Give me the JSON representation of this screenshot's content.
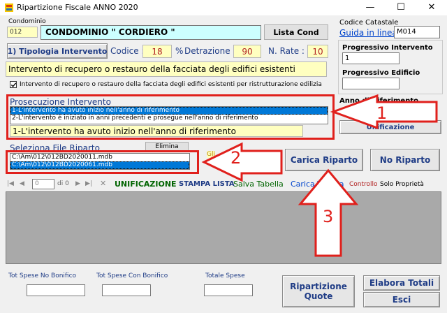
{
  "window": {
    "title": "Ripartizione Fiscale  ANNO 2020",
    "minimize": "—",
    "maximize": "☐",
    "close": "✕"
  },
  "condominio": {
    "label": "Condominio",
    "code": "012",
    "name": "CONDOMINIO \" CORDIERO \"",
    "lista_button": "Lista Cond"
  },
  "catastale": {
    "label": "Codice Catastale",
    "guida_link": "Guida in linea",
    "code": "M014"
  },
  "tipologia": {
    "button": "1) Tipologia Intervento",
    "codice_label": "Codice :",
    "codice_value": "18",
    "percent_sign": "%",
    "detrazione_label": "Detrazione :",
    "detrazione_value": "90",
    "rate_label": "N. Rate :",
    "rate_value": "10",
    "description": "Intervento di recupero o restauro della facciata degli edifici esistenti",
    "checkbox_label": "Intervento di recupero o restauro della facciata degli edifici esistenti per ristrutturazione edilizia",
    "checkbox_checked": true
  },
  "progressivo": {
    "intervento_label": "Progressivo Intervento",
    "intervento_value": "1",
    "edificio_label": "Progressivo Edificio",
    "edificio_value": ""
  },
  "anno": {
    "label": "Anno di Riferimento",
    "unificazione_button": "Unificazione"
  },
  "prosecuzione": {
    "label": "Prosecuzione Intervento",
    "options": [
      "1-L'intervento ha avuto inizio nell'anno di riferimento",
      "2-L'intervento è iniziato in anni precedenti e prosegue nell'anno di riferimento"
    ],
    "selected": "1-L'intervento ha avuto inizio nell'anno di riferimento"
  },
  "file_riparto": {
    "label": "Seleziona File Riparto",
    "elimina_button": "Elimina",
    "files": [
      "C:\\Am\\012\\012BD2020011.mdb",
      "C:\\Am\\012\\012BD2020061.mdb"
    ],
    "side_button": "Gli"
  },
  "actions": {
    "carica_riparto": "Carica Riparto",
    "no_riparto": "No Riparto"
  },
  "toolbar": {
    "first": "|◀",
    "prev": "◀",
    "page": "0",
    "of": "di 0",
    "next": "▶",
    "last": "▶|",
    "delete": "✕",
    "unificazione": "UNIFICAZIONE",
    "stampa_lista": "STAMPA LISTA",
    "salva_tabella": "Salva Tabella",
    "carica_tabella": "Carica Tabella",
    "controllo": "Controllo",
    "solo_proprieta": "Solo Proprietà"
  },
  "totals": {
    "no_bonifico_label": "Tot Spese No Bonifico",
    "con_bonifico_label": "Tot Spese Con Bonifico",
    "totale_label": "Totale Spese",
    "ripartizione_button_line1": "Ripartizione",
    "ripartizione_button_line2": "Quote",
    "elabora_button": "Elabora Totali",
    "esci_button": "Esci"
  },
  "annotations": {
    "arrow1": "1",
    "arrow2": "2",
    "arrow3": "3"
  },
  "colors": {
    "annotation_red": "#e0201c",
    "selection_blue": "#0078d7",
    "button_text_blue": "#1f3c86",
    "yellow_field": "#ffffc0",
    "cyan_field": "#ccffff",
    "number_red": "#b22222",
    "green_text": "#006400",
    "blue_link": "#0044cc"
  }
}
